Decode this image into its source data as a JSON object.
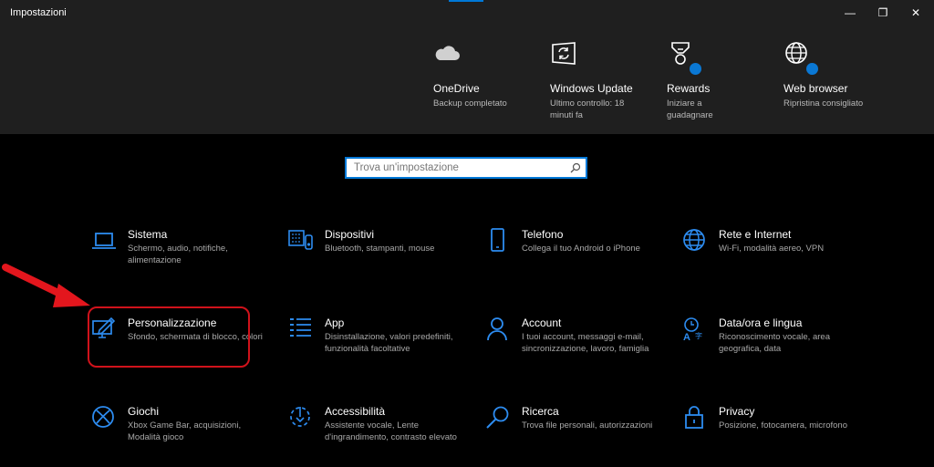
{
  "window": {
    "title": "Impostazioni",
    "controls": {
      "minimize": "—",
      "restore": "❐",
      "close": "✕"
    }
  },
  "header_tiles": [
    {
      "name": "OneDrive",
      "desc": "Backup completato",
      "icon": "cloud-icon"
    },
    {
      "name": "Windows Update",
      "desc": "Ultimo controllo: 18 minuti fa",
      "icon": "update-icon"
    },
    {
      "name": "Rewards",
      "desc": "Iniziare a guadagnare",
      "icon": "trophy-icon"
    },
    {
      "name": "Web browser",
      "desc": "Ripristina consigliato",
      "icon": "globe-icon"
    }
  ],
  "search": {
    "placeholder": "Trova un'impostazione"
  },
  "categories": [
    {
      "name": "Sistema",
      "desc": "Schermo, audio, notifiche, alimentazione"
    },
    {
      "name": "Dispositivi",
      "desc": "Bluetooth, stampanti, mouse"
    },
    {
      "name": "Telefono",
      "desc": "Collega il tuo Android o iPhone"
    },
    {
      "name": "Rete e Internet",
      "desc": "Wi-Fi, modalità aereo, VPN"
    },
    {
      "name": "Personalizzazione",
      "desc": "Sfondo, schermata di blocco, colori"
    },
    {
      "name": "App",
      "desc": "Disinstallazione, valori predefiniti, funzionalità facoltative"
    },
    {
      "name": "Account",
      "desc": "I tuoi account, messaggi e-mail, sincronizzazione, lavoro, famiglia"
    },
    {
      "name": "Data/ora e lingua",
      "desc": "Riconoscimento vocale, area geografica, data"
    },
    {
      "name": "Giochi",
      "desc": "Xbox Game Bar, acquisizioni, Modalità gioco"
    },
    {
      "name": "Accessibilità",
      "desc": "Assistente vocale, Lente d'ingrandimento, contrasto elevato"
    },
    {
      "name": "Ricerca",
      "desc": "Trova file personali, autorizzazioni"
    },
    {
      "name": "Privacy",
      "desc": "Posizione, fotocamera, microfono"
    }
  ],
  "colors": {
    "accent": "#0078d7",
    "icon_blue": "#2d8cf0",
    "highlight": "#d0121b",
    "header_bg": "#1f1f1f"
  }
}
